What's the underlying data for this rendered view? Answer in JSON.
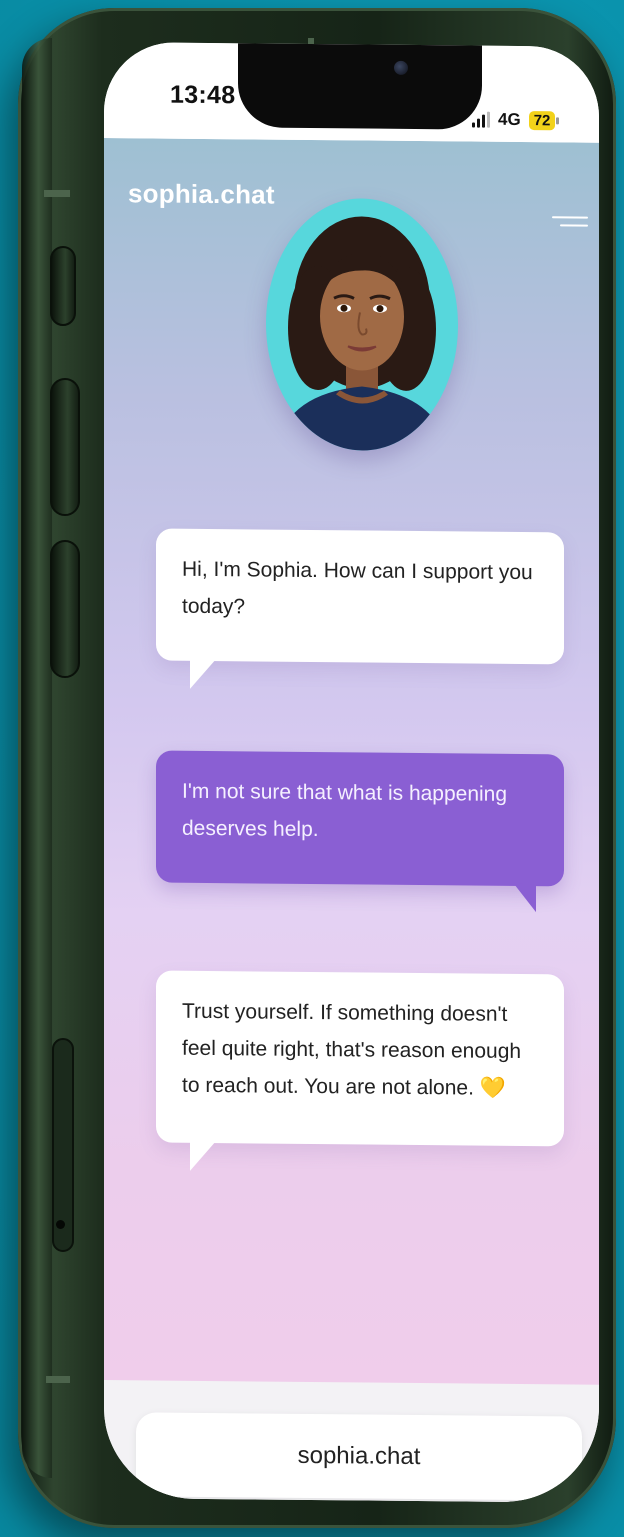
{
  "status_bar": {
    "time": "13:48",
    "network": "4G",
    "battery": "72",
    "icons": [
      "signal-bars-icon",
      "battery-icon"
    ]
  },
  "header": {
    "brand": "sophia.chat",
    "menu_icon": "hamburger-menu-icon"
  },
  "chat": {
    "messages": [
      {
        "sender": "sophia",
        "text": "Hi, I'm Sophia. How can I support you today?"
      },
      {
        "sender": "user",
        "text": "I'm not sure that what is happening deserves help."
      },
      {
        "sender": "sophia",
        "text": "Trust yourself. If something doesn't feel quite right, that's reason enough to reach out. You are not alone.",
        "emoji": "💛"
      }
    ]
  },
  "browser": {
    "url": "sophia.chat"
  },
  "colors": {
    "page_background": "#0a93ad",
    "phone_frame": "#1d2d1d",
    "user_bubble": "#8a5fd3",
    "bot_bubble": "#ffffff",
    "avatar_background": "#57d7dc",
    "battery_badge": "#f2d21a"
  }
}
